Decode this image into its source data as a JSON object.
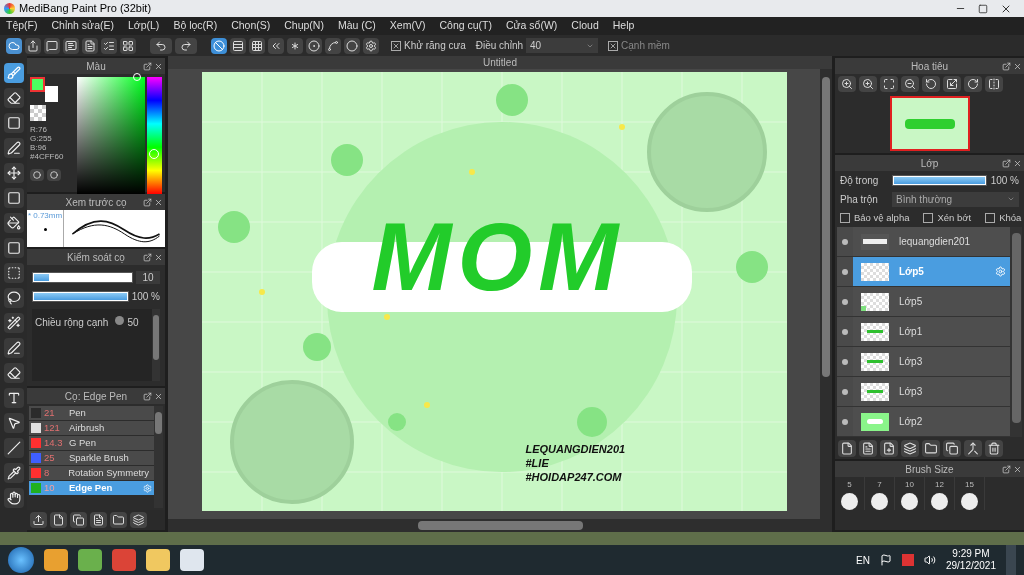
{
  "window": {
    "title": "MediBang Paint Pro (32bit)"
  },
  "menu": [
    "Tệp(F)",
    "Chỉnh sửa(E)",
    "Lớp(L)",
    "Bộ lọc(R)",
    "Chọn(S)",
    "Chụp(N)",
    "Màu (C)",
    "Xem(V)",
    "Công cụ(T)",
    "Cửa sổ(W)",
    "Cloud",
    "Help"
  ],
  "toolbar": {
    "snap_modes": [
      {
        "kind": "none",
        "selected": true
      },
      {
        "kind": "parallel",
        "selected": false
      },
      {
        "kind": "grid",
        "selected": false
      },
      {
        "kind": "perspective",
        "selected": false
      },
      {
        "kind": "radial",
        "selected": false
      },
      {
        "kind": "concentric",
        "selected": false
      },
      {
        "kind": "curve",
        "selected": false
      },
      {
        "kind": "circle",
        "selected": false
      },
      {
        "kind": "settings",
        "selected": false
      }
    ],
    "antialias": {
      "label": "Khử răng cưa",
      "checked": true
    },
    "correction": {
      "label": "Điều chỉnh",
      "value": "40"
    },
    "soft_edge": {
      "label": "Cạnh mềm",
      "checked": true
    }
  },
  "tools": [
    {
      "kind": "brush",
      "selected": true
    },
    {
      "kind": "eraser",
      "selected": false
    },
    {
      "kind": "dot",
      "selected": false
    },
    {
      "kind": "select-pen",
      "selected": false
    },
    {
      "kind": "move",
      "selected": false
    },
    {
      "kind": "fill",
      "selected": false
    },
    {
      "kind": "bucket",
      "selected": false
    },
    {
      "kind": "gradient",
      "selected": false
    },
    {
      "kind": "select",
      "selected": false
    },
    {
      "kind": "lasso",
      "selected": false
    },
    {
      "kind": "wand",
      "selected": false
    },
    {
      "kind": "select-pen",
      "selected": false
    },
    {
      "kind": "select-eraser",
      "selected": false
    },
    {
      "kind": "text",
      "selected": false
    },
    {
      "kind": "operation",
      "selected": false
    },
    {
      "kind": "divide",
      "selected": false
    },
    {
      "kind": "eyedropper",
      "selected": false
    },
    {
      "kind": "hand",
      "selected": false
    }
  ],
  "color_panel": {
    "title": "Màu",
    "lines": [
      "R:76",
      "G:255",
      "B:96",
      "#4CFF60"
    ]
  },
  "brush_preview": {
    "title": "Xem trước cọ",
    "size": "* 0.73mm"
  },
  "brush_control": {
    "title": "Kiểm soát cọ",
    "size": {
      "level": 0.15,
      "value": "10"
    },
    "opacity": {
      "level": 1,
      "value": "100 %"
    },
    "edge": {
      "label": "Chiều rộng cạnh",
      "value": "50"
    }
  },
  "brushes": {
    "title": "Cọ: Edge Pen",
    "items": [
      {
        "color": "#2b2b2b",
        "size": "21",
        "name": "Pen",
        "selected": false
      },
      {
        "color": "#e0e0e0",
        "size": "121",
        "name": "Airbrush",
        "selected": false
      },
      {
        "color": "#ff3030",
        "size": "14.3",
        "name": "G Pen",
        "selected": false
      },
      {
        "color": "#3f5fff",
        "size": "25",
        "name": "Sparkle Brush",
        "selected": false
      },
      {
        "color": "#ff3030",
        "size": "8",
        "name": "Rotation Symmetry",
        "selected": false
      },
      {
        "color": "#20b020",
        "size": "10",
        "name": "Edge Pen",
        "selected": true
      }
    ]
  },
  "canvas": {
    "tab": "Untitled",
    "lettering": "MOM",
    "signature": [
      "LEQUANGDIEN201",
      "#LIE",
      "#HOIDAP247.COM"
    ]
  },
  "navigator": {
    "title": "Hoa tiêu"
  },
  "layers_panel": {
    "title": "Lớp",
    "opacity": {
      "label": "Độ trong",
      "level": 1,
      "value": "100 %"
    },
    "blend": {
      "label": "Pha trộn",
      "value": "Bình thường"
    },
    "options": [
      {
        "label": "Bảo vệ alpha",
        "checked": false
      },
      {
        "label": "Xén bớt",
        "checked": false
      },
      {
        "label": "Khóa",
        "checked": false
      }
    ],
    "layers": [
      {
        "name": "lequangdien201",
        "kind": "text",
        "selected": false
      },
      {
        "name": "Lớp5",
        "kind": "empty",
        "selected": true
      },
      {
        "name": "Lớp5",
        "kind": "corner",
        "selected": false
      },
      {
        "name": "Lớp1",
        "kind": "lettering",
        "selected": false
      },
      {
        "name": "Lớp3",
        "kind": "lettering",
        "selected": false
      },
      {
        "name": "Lớp3",
        "kind": "lettering",
        "selected": false
      },
      {
        "name": "Lớp2",
        "kind": "filled",
        "selected": false
      }
    ]
  },
  "brush_size": {
    "title": "Brush Size",
    "sizes": [
      "5",
      "7",
      "10",
      "12",
      "15"
    ]
  },
  "taskbar": {
    "language": "EN",
    "time": "9:29 PM",
    "date": "29/12/2021"
  }
}
